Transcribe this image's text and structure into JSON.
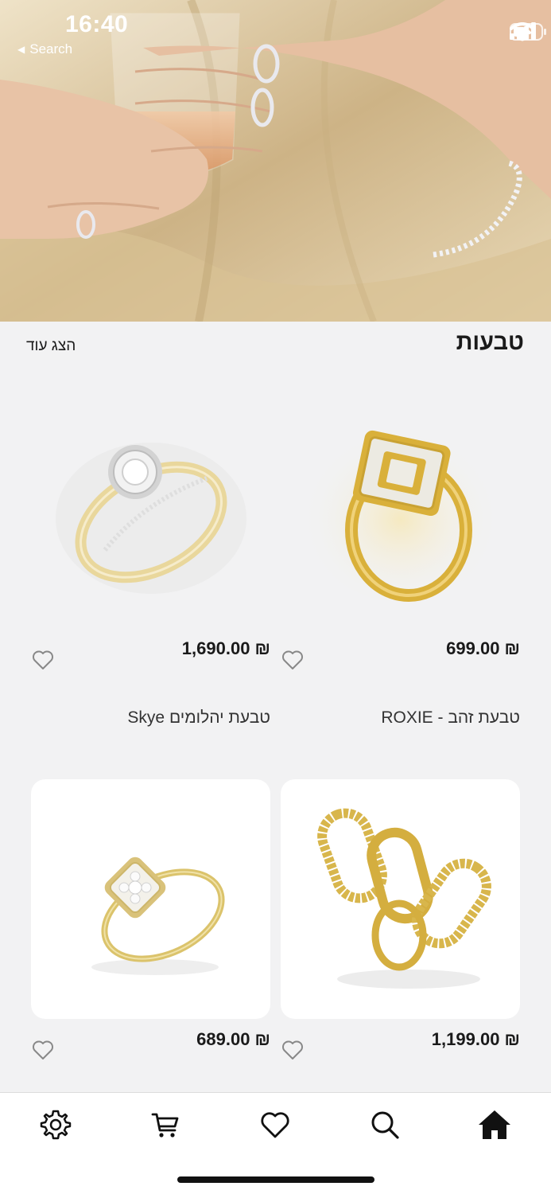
{
  "status_bar": {
    "time": "16:40",
    "back_label": "Search",
    "icons": [
      "cellular-signal-icon",
      "wifi-icon",
      "battery-icon"
    ]
  },
  "hero": {
    "image": "woman-holding-wine-glass-wearing-rings-and-bracelet"
  },
  "section": {
    "title": "טבעות",
    "show_more": "הצג עוד"
  },
  "products": [
    {
      "name": "טבעת זהב - ROXIE",
      "price": "₪ 699.00",
      "image": "gold-rectangular-halo-diamond-ring"
    },
    {
      "name": "טבעת יהלומים Skye",
      "price": "₪ 1,690.00",
      "image": "round-halo-diamond-ring"
    },
    {
      "name": "",
      "price": "₪ 1,199.00",
      "image": "gold-oval-link-diamond-ring"
    },
    {
      "name": "",
      "price": "₪ 689.00",
      "image": "square-cluster-diamond-ring"
    }
  ],
  "bottom_nav": {
    "items": [
      "gear-icon",
      "cart-icon",
      "heart-icon",
      "search-icon",
      "home-icon"
    ],
    "active": "home-icon"
  },
  "colors": {
    "gold": "#d9b44a",
    "background": "#f2f2f3",
    "text": "#1a1a1a"
  }
}
